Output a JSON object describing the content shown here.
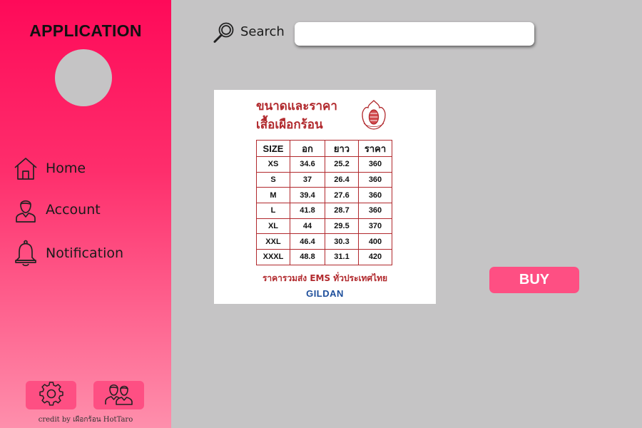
{
  "sidebar": {
    "app_title": "APPLICATION",
    "nav": [
      {
        "label": "Home",
        "icon": "home-icon"
      },
      {
        "label": "Account",
        "icon": "user-icon"
      },
      {
        "label": "Notification",
        "icon": "bell-icon"
      }
    ],
    "bottom_buttons": [
      {
        "icon": "gear-icon"
      },
      {
        "icon": "users-icon"
      }
    ],
    "credit": "credit by เผือกร้อน HotTaro"
  },
  "header": {
    "search_label": "Search",
    "search_value": ""
  },
  "product": {
    "title": "ขนาดและราคา\nเสื้อเผือกร้อน",
    "table": {
      "headers": [
        "SIZE",
        "อก",
        "ยาว",
        "ราคา"
      ],
      "rows": [
        [
          "XS",
          "34.6",
          "25.2",
          "360"
        ],
        [
          "S",
          "37",
          "26.4",
          "360"
        ],
        [
          "M",
          "39.4",
          "27.6",
          "360"
        ],
        [
          "L",
          "41.8",
          "28.7",
          "360"
        ],
        [
          "XL",
          "44",
          "29.5",
          "370"
        ],
        [
          "XXL",
          "46.4",
          "30.3",
          "400"
        ],
        [
          "XXXL",
          "48.8",
          "31.1",
          "420"
        ]
      ]
    },
    "note": "ราคารวมส่ง EMS ทั่วประเทศไทย",
    "brand": "GILDAN"
  },
  "buy_label": "BUY",
  "colors": {
    "sidebar_top": "#fe0a59",
    "sidebar_bottom": "#fe8fac",
    "button": "#fe4f83",
    "background": "#c5c4c5",
    "table_red": "#b1292d",
    "brand_blue": "#1d4e9b"
  }
}
